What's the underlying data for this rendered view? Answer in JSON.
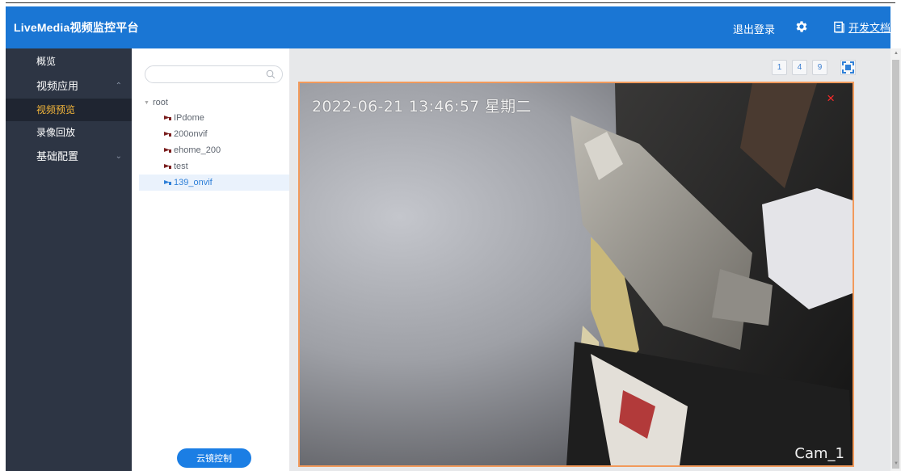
{
  "header": {
    "brand": "LiveMedia视频监控平台",
    "logout": "退出登录",
    "settings_icon": "gear-icon",
    "docs_icon": "document-icon",
    "docs_label": "开发文档",
    "bg_color": "#1a76d4"
  },
  "sidebar": {
    "items": [
      {
        "label": "概览",
        "active": false
      },
      {
        "label": "视频应用",
        "expanded": true,
        "caret": "^"
      },
      {
        "label": "视频预览",
        "active": true
      },
      {
        "label": "录像回放",
        "active": false
      },
      {
        "label": "基础配置",
        "expanded": false,
        "caret": "v"
      }
    ],
    "bg_color": "#2d3544",
    "active_color": "#f5b73a"
  },
  "tree": {
    "search": {
      "value": "",
      "placeholder": ""
    },
    "root_label": "root",
    "nodes": [
      {
        "label": "IPdome",
        "selected": false
      },
      {
        "label": "200onvif",
        "selected": false
      },
      {
        "label": "ehome_200",
        "selected": false
      },
      {
        "label": "test",
        "selected": false
      },
      {
        "label": "139_onvif",
        "selected": true
      }
    ],
    "ptz_button": "云镜控制"
  },
  "toolbar": {
    "split_options": [
      "1",
      "4",
      "9"
    ],
    "fullscreen_icon": "fullscreen-icon"
  },
  "video": {
    "timestamp": "2022-06-21 13:46:57 星期二",
    "camera_name": "Cam_1",
    "close_label": "×",
    "border_color": "#f29a5b"
  }
}
